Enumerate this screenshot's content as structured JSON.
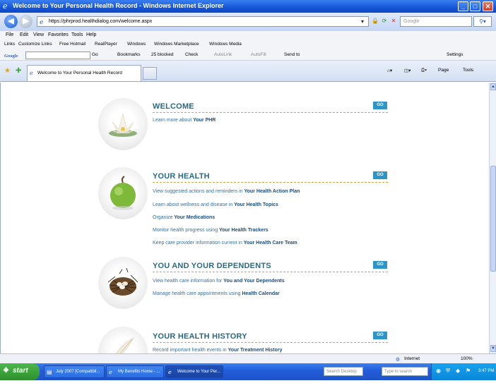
{
  "window": {
    "title": "Welcome to Your Personal Health Record - Windows Internet Explorer"
  },
  "address": {
    "url": "https://phrprod.healthdialog.com/welcome.aspx",
    "search_placeholder": "Google"
  },
  "menu": [
    "File",
    "Edit",
    "View",
    "Favorites",
    "Tools",
    "Help"
  ],
  "links_bar": {
    "label": "Links",
    "items": [
      "Customize Links",
      "Free Hotmail",
      "RealPlayer",
      "Windows",
      "Windows Marketplace",
      "Windows Media"
    ]
  },
  "google_toolbar": {
    "logo": "Google",
    "go": "Go",
    "bookmarks": "Bookmarks",
    "blocked": "25 blocked",
    "check": "Check",
    "autolink": "AutoLink",
    "autofill": "AutoFill",
    "send_to": "Send to",
    "settings": "Settings"
  },
  "tabbar": {
    "tab_title": "Welcome to Your Personal Health Record",
    "page": "Page",
    "tools": "Tools"
  },
  "sections": [
    {
      "title": "WELCOME",
      "go": "GO",
      "image": "lotus-flower-image",
      "lines": [
        {
          "text": "Learn more about ",
          "bold": "Your PHR"
        }
      ]
    },
    {
      "title": "YOUR HEALTH",
      "go": "GO",
      "image": "green-apple-image",
      "lines": [
        {
          "text": "View suggested actions and reminders in ",
          "bold": "Your Health Action Plan"
        },
        {
          "text": "Learn about wellness and disease in ",
          "bold": "Your Health Topics"
        },
        {
          "text": "Organize ",
          "bold": "Your Medications"
        },
        {
          "text": "Monitor health progress using ",
          "bold": "Your Health Trackers"
        },
        {
          "text": "Keep care provider information current in ",
          "bold": "Your Health Care Team"
        }
      ]
    },
    {
      "title": "YOU AND YOUR DEPENDENTS",
      "go": "GO",
      "image": "bird-nest-image",
      "lines": [
        {
          "text": "View health care information for ",
          "bold": "You and Your Dependents"
        },
        {
          "text": "Manage health care appointments using ",
          "bold": "Health Calendar"
        }
      ]
    },
    {
      "title": "YOUR HEALTH HISTORY",
      "go": "GO",
      "image": "feather-image",
      "lines": [
        {
          "text": "Record important health events in ",
          "bold": "Your Treatment History"
        }
      ]
    }
  ],
  "statusbar": {
    "zone": "Internet",
    "zoom": "100%"
  },
  "taskbar": {
    "start": "start",
    "tasks": [
      "July 2007 [Compatibil...",
      "My Benefits Home - ...",
      "Welcome to Your Per..."
    ],
    "desktop_search": "Search Desktop",
    "type_search": "Type to search",
    "clock": "3:47 PM"
  }
}
